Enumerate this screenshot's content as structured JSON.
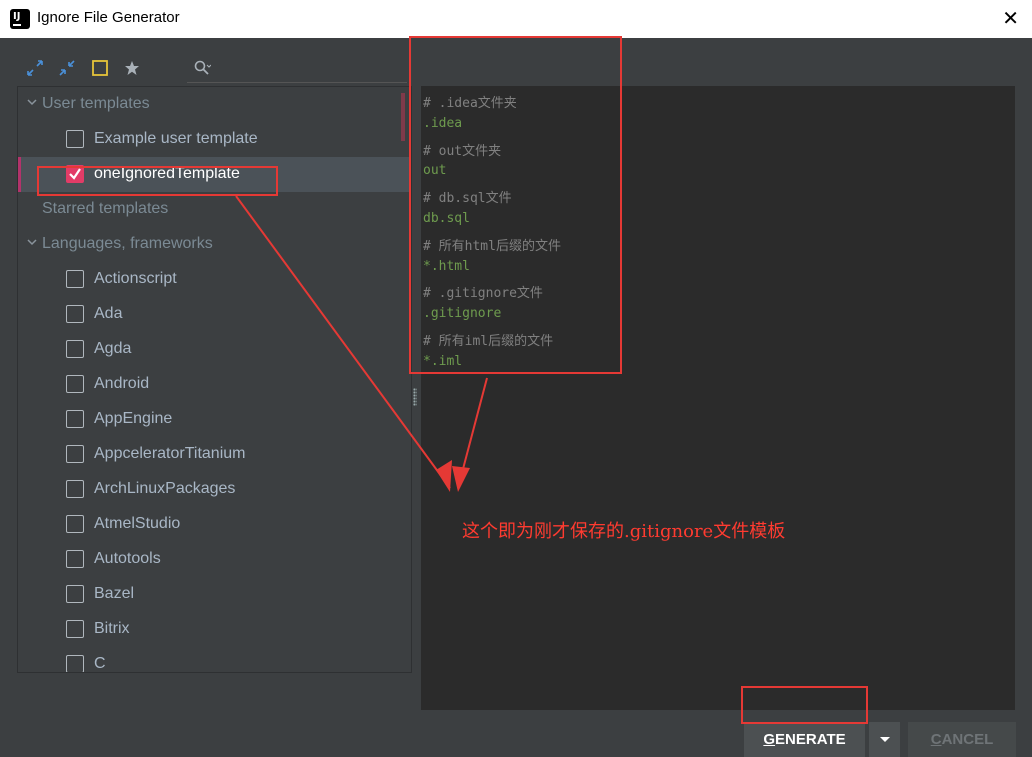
{
  "window": {
    "title": "Ignore File Generator",
    "close_glyph": "✕",
    "icon_name": "intellij-idea-icon"
  },
  "toolbar": {
    "icons": [
      "expand-all-icon",
      "collapse-all-icon",
      "select-icon",
      "star-icon",
      "search-icon"
    ],
    "accent_color": "#e5c33a"
  },
  "tree": {
    "rows": [
      {
        "label": "User templates",
        "type": "group"
      },
      {
        "label": "Example user template",
        "type": "item",
        "checked": false
      },
      {
        "label": "oneIgnoredTemplate",
        "type": "item",
        "checked": true,
        "selected": true
      },
      {
        "label": "Starred templates",
        "type": "group"
      },
      {
        "label": "Languages, frameworks",
        "type": "group"
      },
      {
        "label": "Actionscript",
        "type": "item",
        "checked": false
      },
      {
        "label": "Ada",
        "type": "item",
        "checked": false
      },
      {
        "label": "Agda",
        "type": "item",
        "checked": false
      },
      {
        "label": "Android",
        "type": "item",
        "checked": false
      },
      {
        "label": "AppEngine",
        "type": "item",
        "checked": false
      },
      {
        "label": "AppceleratorTitanium",
        "type": "item",
        "checked": false
      },
      {
        "label": "ArchLinuxPackages",
        "type": "item",
        "checked": false
      },
      {
        "label": "AtmelStudio",
        "type": "item",
        "checked": false
      },
      {
        "label": "Autotools",
        "type": "item",
        "checked": false
      },
      {
        "label": "Bazel",
        "type": "item",
        "checked": false
      },
      {
        "label": "Bitrix",
        "type": "item",
        "checked": false
      },
      {
        "label": "C",
        "type": "item",
        "checked": false
      }
    ]
  },
  "editor": {
    "lines": [
      {
        "text": "# .idea文件夹",
        "kind": "comment"
      },
      {
        "text": ".idea",
        "kind": "code"
      },
      {
        "text": "# out文件夹",
        "kind": "comment"
      },
      {
        "text": "out",
        "kind": "code"
      },
      {
        "text": "# db.sql文件",
        "kind": "comment"
      },
      {
        "text": "db.sql",
        "kind": "code"
      },
      {
        "text": "# 所有html后缀的文件",
        "kind": "comment"
      },
      {
        "text": "*.html",
        "kind": "code"
      },
      {
        "text": "# .gitignore文件",
        "kind": "comment"
      },
      {
        "text": ".gitignore",
        "kind": "code"
      },
      {
        "text": "# 所有iml后缀的文件",
        "kind": "comment"
      },
      {
        "text": "*.iml",
        "kind": "code"
      }
    ]
  },
  "annotation": {
    "text": "这个即为刚才保存的.gitignore文件模板",
    "color": "#e53935"
  },
  "buttons": {
    "generate_mnemonic": "G",
    "generate_rest": "ENERATE",
    "cancel_mnemonic": "C",
    "cancel_rest": "ANCEL"
  }
}
